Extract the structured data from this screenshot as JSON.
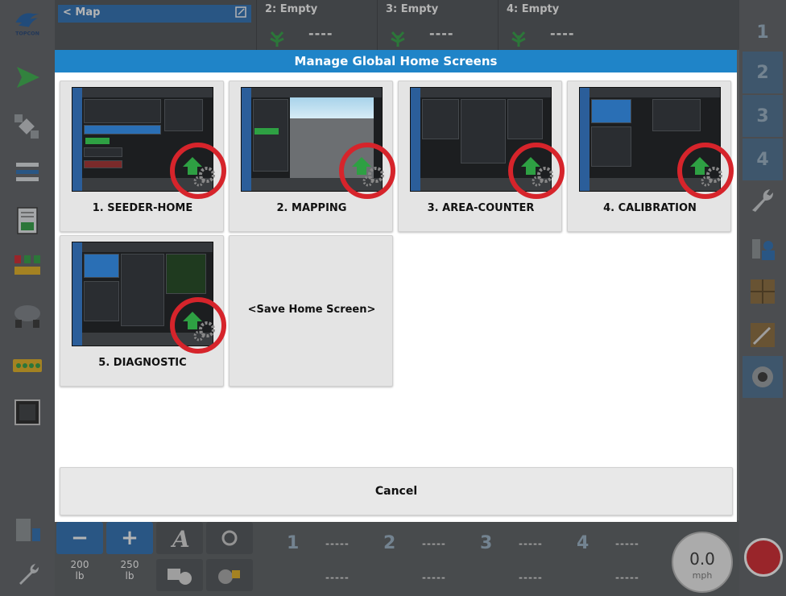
{
  "top_bar": {
    "map_label": "< Map",
    "slots": [
      {
        "label": "2: Empty",
        "value": "----"
      },
      {
        "label": "3: Empty",
        "value": "----"
      },
      {
        "label": "4: Empty",
        "value": "----"
      }
    ]
  },
  "right_bar": {
    "section_numbers": [
      "1",
      "2",
      "3",
      "4"
    ]
  },
  "bottom_bar": {
    "minus_label": "−",
    "plus_label": "+",
    "rate_1": "200\nlb",
    "rate_2": "250\nlb",
    "bins": [
      {
        "number": "1",
        "value_top": "-----",
        "value_bottom": "-----"
      },
      {
        "number": "2",
        "value_top": "-----",
        "value_bottom": "-----"
      },
      {
        "number": "3",
        "value_top": "-----",
        "value_bottom": "-----"
      },
      {
        "number": "4",
        "value_top": "-----",
        "value_bottom": "-----"
      }
    ],
    "speed_value": "0.0",
    "speed_unit": "mph"
  },
  "modal": {
    "title": "Manage Global Home Screens",
    "tiles": [
      {
        "label": "1. SEEDER-HOME"
      },
      {
        "label": "2. MAPPING"
      },
      {
        "label": "3. AREA-COUNTER"
      },
      {
        "label": "4. CALIBRATION"
      },
      {
        "label": "5. DIAGNOSTIC"
      }
    ],
    "save_label": "<Save Home Screen>",
    "cancel_label": "Cancel"
  },
  "logo_text": "TOPCON",
  "colors": {
    "header_blue": "#1f84c8",
    "badge_red": "#d6242b",
    "home_green": "#2ea043"
  }
}
